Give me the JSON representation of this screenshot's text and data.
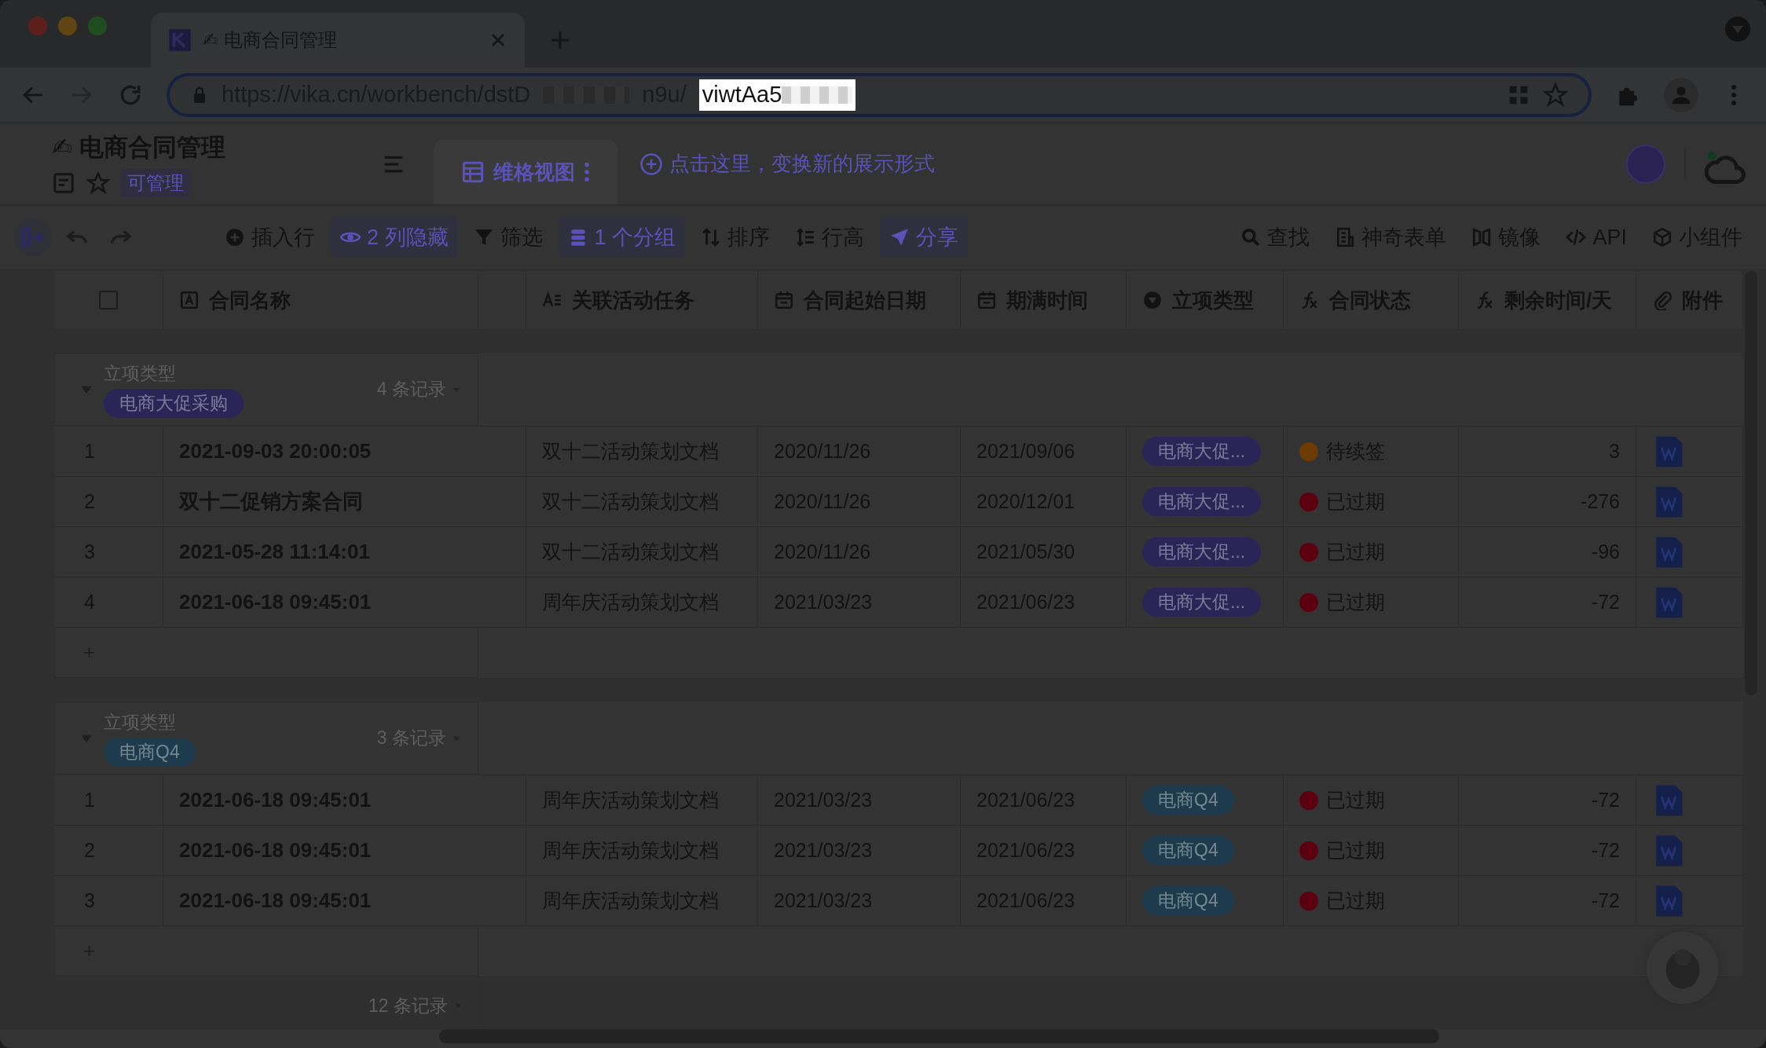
{
  "browser": {
    "tab": {
      "title": "✍ 电商合同管理"
    },
    "url": {
      "start": "https://vika.cn/workbench/dstD",
      "middle": "n9u/",
      "highlighted": "viwtAa5"
    }
  },
  "header": {
    "title": "✍ 电商合同管理",
    "permission": "可管理",
    "view_tabs": [
      {
        "label": "维格视图",
        "selected": true
      }
    ],
    "view_hint": "点击这里，变换新的展示形式"
  },
  "toolbar": {
    "left": [
      {
        "label": "插入行",
        "active": false
      },
      {
        "label": "2 列隐藏",
        "active": true
      },
      {
        "label": "筛选",
        "active": false
      },
      {
        "label": "1 个分组",
        "active": true
      },
      {
        "label": "排序",
        "active": false
      },
      {
        "label": "行高",
        "active": false
      },
      {
        "label": "分享",
        "active": true
      }
    ],
    "right": [
      {
        "label": "查找",
        "active": false
      },
      {
        "label": "神奇表单",
        "active": false
      },
      {
        "label": "镜像",
        "active": false
      },
      {
        "label": "API",
        "active": false
      },
      {
        "label": "小组件",
        "active": false
      }
    ]
  },
  "table": {
    "select_all": {
      "checked": false
    },
    "columns": [
      {
        "label": "合同名称",
        "kind": "text"
      },
      {
        "label": "关联活动任务",
        "kind": "multitext"
      },
      {
        "label": "合同起始日期",
        "kind": "date"
      },
      {
        "label": "期满时间",
        "kind": "date"
      },
      {
        "label": "立项类型",
        "kind": "select"
      },
      {
        "label": "合同状态",
        "kind": "formula"
      },
      {
        "label": "剩余时间/天",
        "kind": "formula"
      },
      {
        "label": "附件",
        "kind": "attachment"
      }
    ],
    "groups": [
      {
        "field": "立项类型",
        "tag": {
          "label": "电商大促采购",
          "color": "#2b2456"
        },
        "count": "4 条记录",
        "expanded": true,
        "add_row": "+",
        "rows": [
          {
            "index": "1",
            "name": "2021-09-03 20:00:05",
            "task": "双十二活动策划文档",
            "start": "2020/11/26",
            "end": "2021/09/06",
            "type": {
              "label": "电商大促...",
              "color": "#2b2456"
            },
            "status": {
              "label": "待续签",
              "color": "#6e3b00"
            },
            "remaining": "3"
          },
          {
            "index": "2",
            "name": "双十二促销方案合同",
            "task": "双十二活动策划文档",
            "start": "2020/11/26",
            "end": "2020/12/01",
            "type": {
              "label": "电商大促...",
              "color": "#2b2456"
            },
            "status": {
              "label": "已过期",
              "color": "#5c0010"
            },
            "remaining": "-276"
          },
          {
            "index": "3",
            "name": "2021-05-28 11:14:01",
            "task": "双十二活动策划文档",
            "start": "2020/11/26",
            "end": "2021/05/30",
            "type": {
              "label": "电商大促...",
              "color": "#2b2456"
            },
            "status": {
              "label": "已过期",
              "color": "#5c0010"
            },
            "remaining": "-96"
          },
          {
            "index": "4",
            "name": "2021-06-18 09:45:01",
            "task": "周年庆活动策划文档",
            "start": "2021/03/23",
            "end": "2021/06/23",
            "type": {
              "label": "电商大促...",
              "color": "#2b2456"
            },
            "status": {
              "label": "已过期",
              "color": "#5c0010"
            },
            "remaining": "-72"
          }
        ]
      },
      {
        "field": "立项类型",
        "tag": {
          "label": "电商Q4",
          "color": "#1d3b4c"
        },
        "count": "3 条记录",
        "expanded": true,
        "add_row": "+",
        "rows": [
          {
            "index": "1",
            "name": "2021-06-18 09:45:01",
            "task": "周年庆活动策划文档",
            "start": "2021/03/23",
            "end": "2021/06/23",
            "type": {
              "label": "电商Q4",
              "color": "#1d3b4c"
            },
            "status": {
              "label": "已过期",
              "color": "#5c0010"
            },
            "remaining": "-72"
          },
          {
            "index": "2",
            "name": "2021-06-18 09:45:01",
            "task": "周年庆活动策划文档",
            "start": "2021/03/23",
            "end": "2021/06/23",
            "type": {
              "label": "电商Q4",
              "color": "#1d3b4c"
            },
            "status": {
              "label": "已过期",
              "color": "#5c0010"
            },
            "remaining": "-72"
          },
          {
            "index": "3",
            "name": "2021-06-18 09:45:01",
            "task": "周年庆活动策划文档",
            "start": "2021/03/23",
            "end": "2021/06/23",
            "type": {
              "label": "电商Q4",
              "color": "#1d3b4c"
            },
            "status": {
              "label": "已过期",
              "color": "#5c0010"
            },
            "remaining": "-72"
          }
        ]
      }
    ],
    "footer": "12 条记录"
  }
}
